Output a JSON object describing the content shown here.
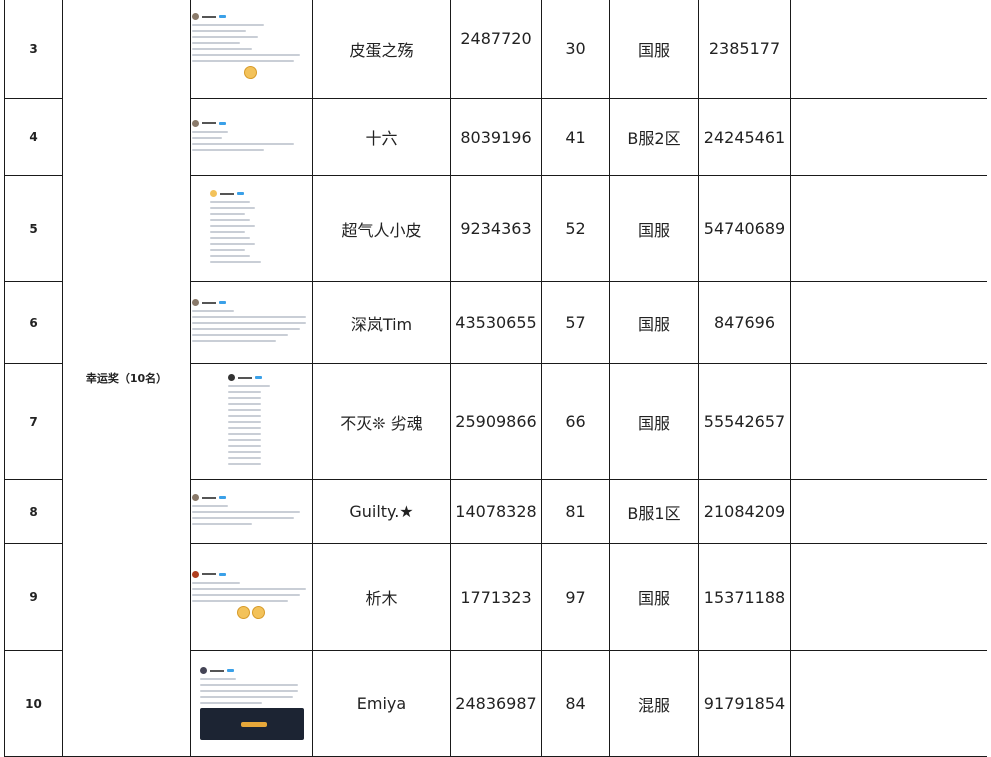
{
  "award_label": "幸运奖（10名）",
  "rows": [
    {
      "rank": "3",
      "name": "皮蛋之殇",
      "uid": "2487720",
      "level": "30",
      "server": "国服",
      "account": "2385177"
    },
    {
      "rank": "4",
      "name": "十六",
      "uid": "8039196",
      "level": "41",
      "server": "B服2区",
      "account": "24245461"
    },
    {
      "rank": "5",
      "name": "超气人小皮",
      "uid": "9234363",
      "level": "52",
      "server": "国服",
      "account": "54740689"
    },
    {
      "rank": "6",
      "name": "深岚Tim",
      "uid": "43530655",
      "level": "57",
      "server": "国服",
      "account": "847696"
    },
    {
      "rank": "7",
      "name": "不灭❊ 劣魂",
      "uid": "25909866",
      "level": "66",
      "server": "国服",
      "account": "55542657"
    },
    {
      "rank": "8",
      "name": "Guilty.★",
      "uid": "14078328",
      "level": "81",
      "server": "B服1区",
      "account": "21084209"
    },
    {
      "rank": "9",
      "name": "析木",
      "uid": "1771323",
      "level": "97",
      "server": "国服",
      "account": "15371188"
    },
    {
      "rank": "10",
      "name": "Emiya",
      "uid": "24836987",
      "level": "84",
      "server": "混服",
      "account": "91791854"
    }
  ]
}
